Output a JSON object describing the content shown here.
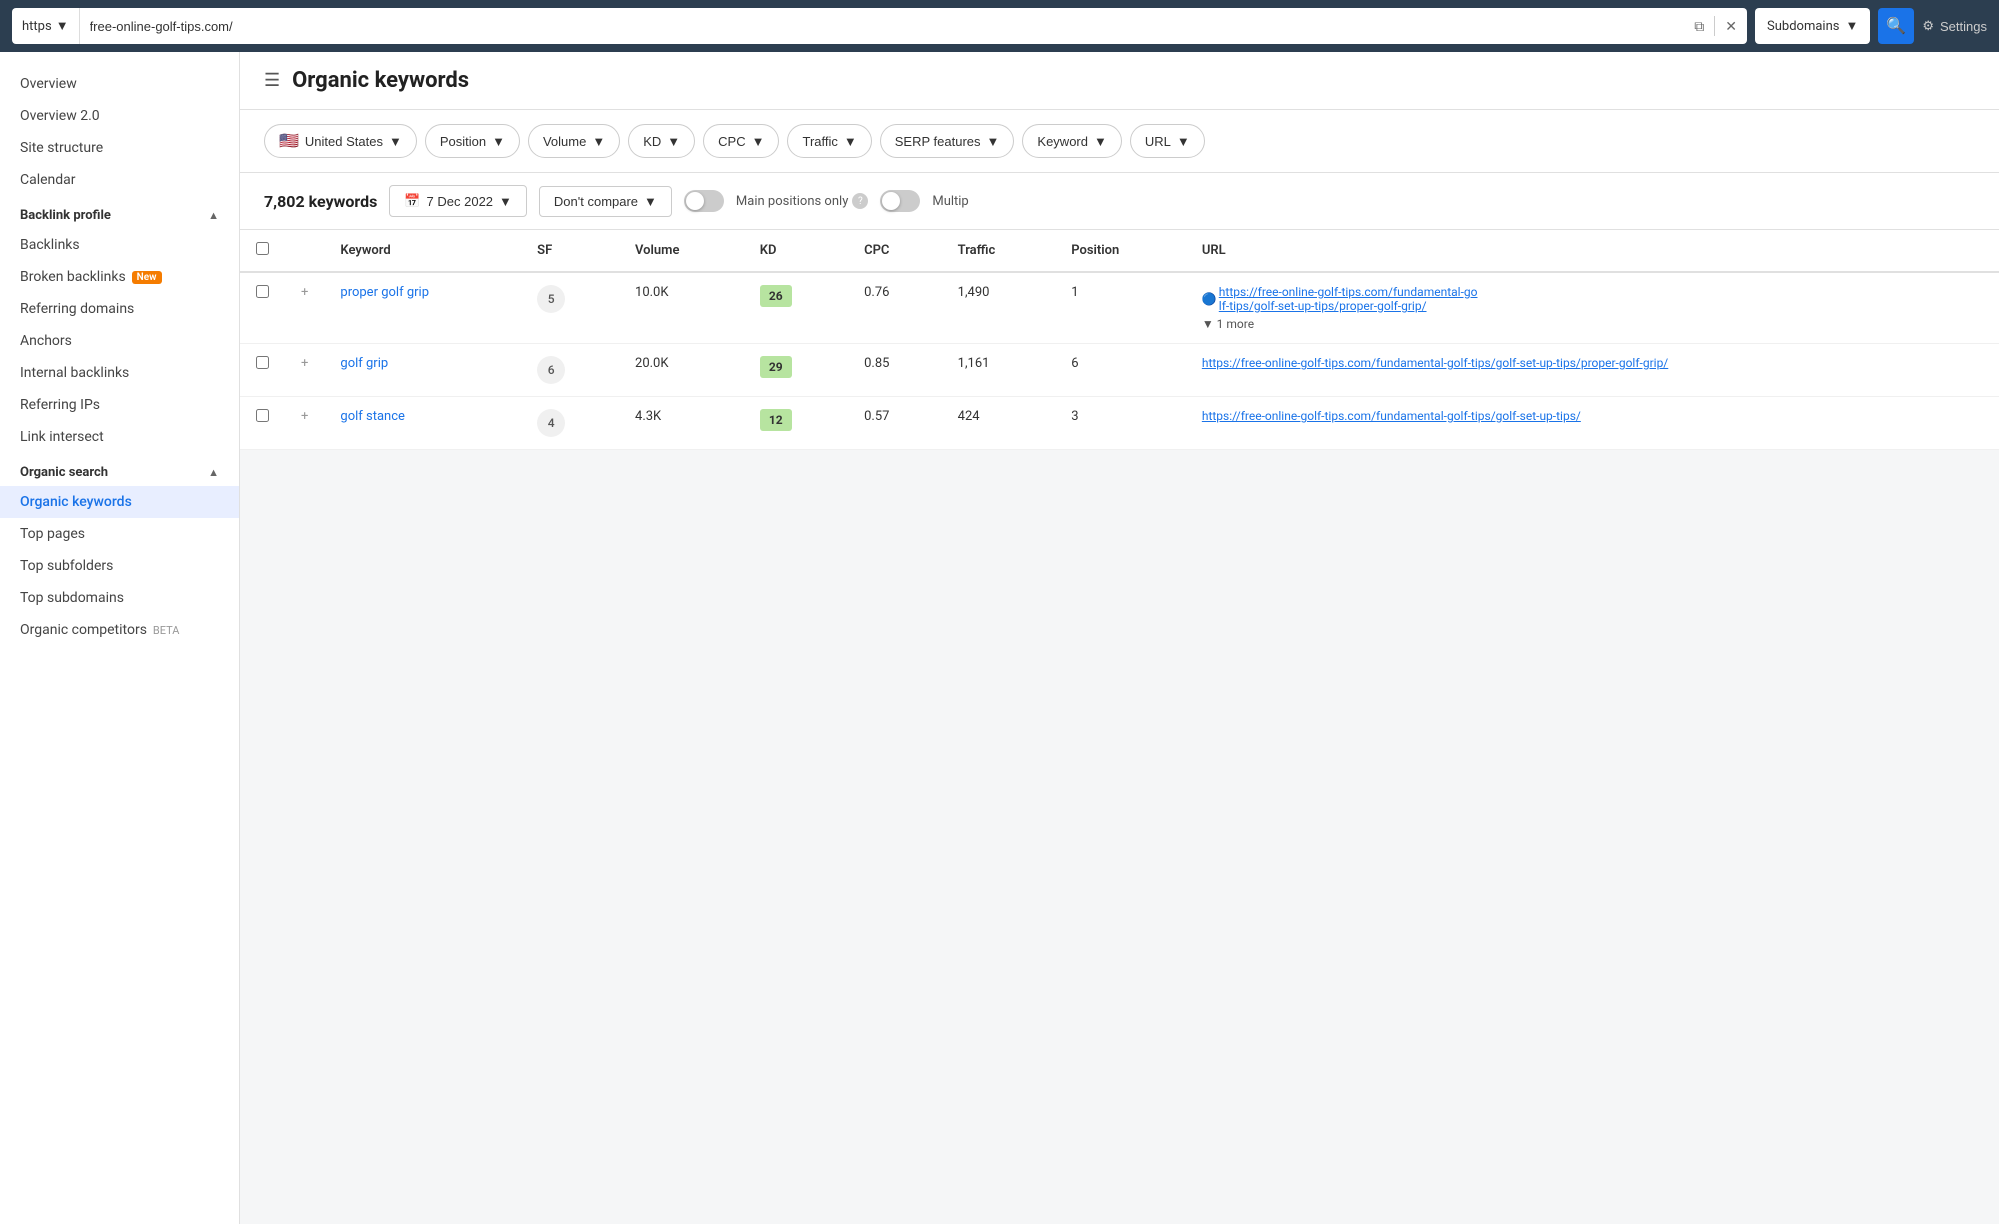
{
  "topbar": {
    "protocol": "https",
    "protocol_chevron": "▼",
    "url": "free-online-golf-tips.com/",
    "open_icon": "⧉",
    "close_icon": "✕",
    "subdomains_label": "Subdomains",
    "subdomains_chevron": "▼",
    "search_icon": "🔍",
    "settings_icon": "⚙",
    "settings_label": "Settings"
  },
  "sidebar": {
    "top_items": [
      {
        "label": "Overview",
        "active": false
      },
      {
        "label": "Overview 2.0",
        "active": false
      },
      {
        "label": "Site structure",
        "active": false
      },
      {
        "label": "Calendar",
        "active": false
      }
    ],
    "sections": [
      {
        "header": "Backlink profile",
        "collapsed": false,
        "items": [
          {
            "label": "Backlinks",
            "active": false
          },
          {
            "label": "Broken backlinks",
            "active": false,
            "badge": "New"
          },
          {
            "label": "Referring domains",
            "active": false
          },
          {
            "label": "Anchors",
            "active": false
          },
          {
            "label": "Internal backlinks",
            "active": false
          },
          {
            "label": "Referring IPs",
            "active": false
          },
          {
            "label": "Link intersect",
            "active": false
          }
        ]
      },
      {
        "header": "Organic search",
        "collapsed": false,
        "items": [
          {
            "label": "Organic keywords",
            "active": true
          },
          {
            "label": "Top pages",
            "active": false
          },
          {
            "label": "Top subfolders",
            "active": false
          },
          {
            "label": "Top subdomains",
            "active": false
          },
          {
            "label": "Organic competitors",
            "active": false,
            "badge": "BETA"
          }
        ]
      }
    ]
  },
  "page": {
    "title": "Organic keywords",
    "hamburger": "☰"
  },
  "filters": [
    {
      "id": "country",
      "flag": "🇺🇸",
      "label": "United States",
      "has_chevron": true
    },
    {
      "id": "position",
      "label": "Position",
      "has_chevron": true
    },
    {
      "id": "volume",
      "label": "Volume",
      "has_chevron": true
    },
    {
      "id": "kd",
      "label": "KD",
      "has_chevron": true
    },
    {
      "id": "cpc",
      "label": "CPC",
      "has_chevron": true
    },
    {
      "id": "traffic",
      "label": "Traffic",
      "has_chevron": true
    },
    {
      "id": "serp",
      "label": "SERP features",
      "has_chevron": true
    },
    {
      "id": "keyword",
      "label": "Keyword",
      "has_chevron": true
    },
    {
      "id": "url",
      "label": "URL",
      "has_chevron": true
    }
  ],
  "toolbar": {
    "keywords_count": "7,802 keywords",
    "date_icon": "📅",
    "date_label": "7 Dec 2022",
    "date_chevron": "▼",
    "compare_label": "Don't compare",
    "compare_chevron": "▼",
    "main_positions_label": "Main positions only",
    "multi_label": "Multip"
  },
  "table": {
    "columns": [
      {
        "id": "checkbox",
        "label": ""
      },
      {
        "id": "plus",
        "label": ""
      },
      {
        "id": "keyword",
        "label": "Keyword"
      },
      {
        "id": "sf",
        "label": "SF"
      },
      {
        "id": "volume",
        "label": "Volume"
      },
      {
        "id": "kd",
        "label": "KD"
      },
      {
        "id": "cpc",
        "label": "CPC"
      },
      {
        "id": "traffic",
        "label": "Traffic"
      },
      {
        "id": "position",
        "label": "Position"
      },
      {
        "id": "url",
        "label": "URL"
      }
    ],
    "rows": [
      {
        "keyword": "proper golf grip",
        "sf": "5",
        "volume": "10.0K",
        "kd": "26",
        "kd_class": "kd-low",
        "cpc": "0.76",
        "traffic": "1,490",
        "position": "1",
        "url": "https://free-online-golf-tips.com/fundamental-golf-tips/golf-set-up-tips/proper-golf-grip/",
        "url_short": "https://free-online-golf-ti\ns.com/fundamental-golf-ti\nps/golf-set-up-tips/prope\nr-golf-grip/",
        "more": "▼ 1 more"
      },
      {
        "keyword": "golf grip",
        "sf": "6",
        "volume": "20.0K",
        "kd": "29",
        "kd_class": "kd-low",
        "cpc": "0.85",
        "traffic": "1,161",
        "position": "6",
        "url": "https://free-online-golf-tips.com/fundamental-golf-tips/golf-set-up-tips/proper-golf-grip/",
        "url_short": "https://free-online-golf-ti\ns.com/fundamental-golf-ti\nps/golf-set-up-tips/prope\nr-golf-grip/",
        "more": ""
      },
      {
        "keyword": "golf stance",
        "sf": "4",
        "volume": "4.3K",
        "kd": "12",
        "kd_class": "kd-low",
        "cpc": "0.57",
        "traffic": "424",
        "position": "3",
        "url": "https://free-online-golf-tips.com/fundamental-golf-tips/golf-set-up-tips/",
        "url_short": "https://free-online-golf-ti\nps/golf-set-up-tips/",
        "more": ""
      }
    ]
  }
}
